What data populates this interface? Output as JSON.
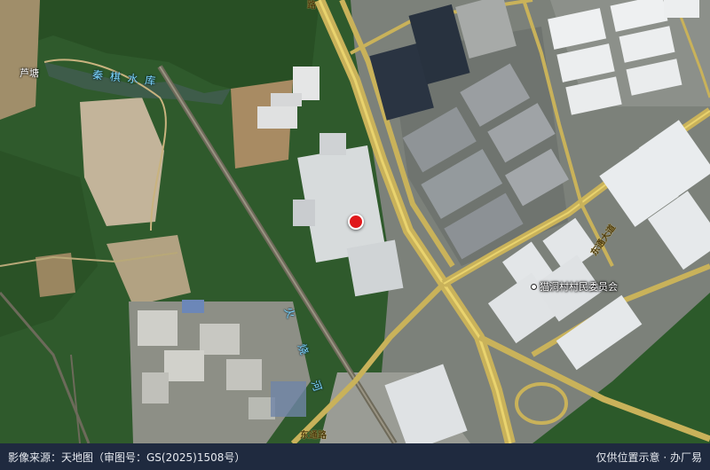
{
  "map": {
    "labels": {
      "lutang": "芦塘",
      "reservoir": "秦 棋 水 库",
      "river": "火 烧 河",
      "poi": "猫洞村村民委员会",
      "road_ne": "东通大道",
      "road_top": "路",
      "road_bottom": "东通路"
    },
    "marker_color": "#e0181b",
    "base_type": "satellite-imagery"
  },
  "footer": {
    "source": "影像来源：天地图（审图号：GS(2025)1508号）",
    "disclaimer": "仅供位置示意 · 办厂易"
  }
}
